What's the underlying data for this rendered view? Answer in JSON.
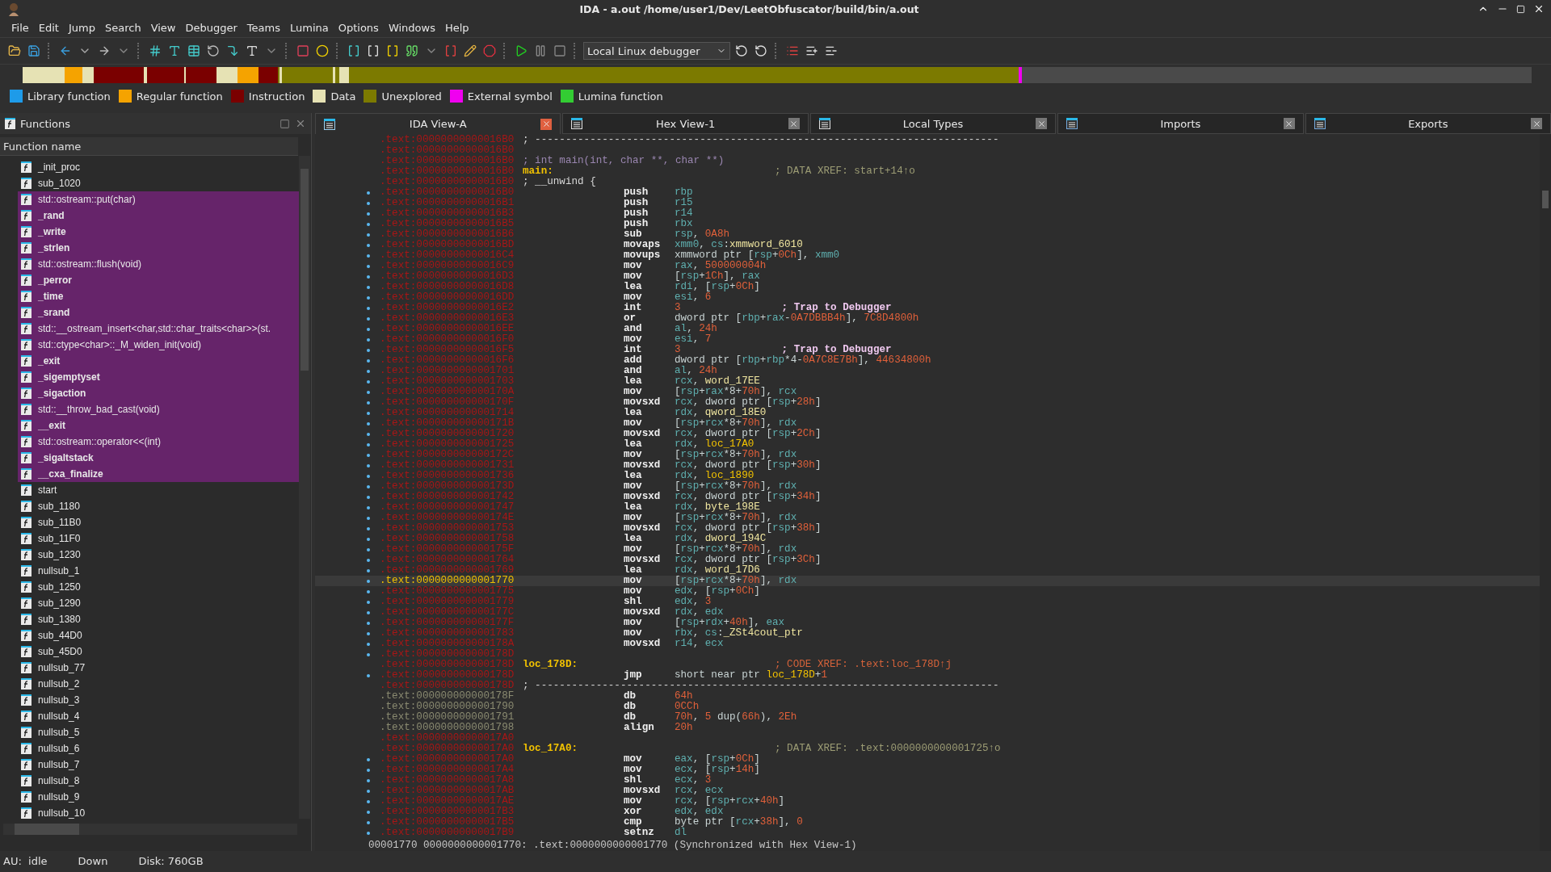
{
  "window": {
    "title": "IDA - a.out /home/user1/Dev/LeetObfuscator/build/bin/a.out"
  },
  "menu": [
    "File",
    "Edit",
    "Jump",
    "Search",
    "View",
    "Debugger",
    "Teams",
    "Lumina",
    "Options",
    "Windows",
    "Help"
  ],
  "toolbar": {
    "debugger_select": "Local Linux debugger"
  },
  "legend": [
    {
      "label": "Library function",
      "color": "#1e9be9"
    },
    {
      "label": "Regular function",
      "color": "#f5a300"
    },
    {
      "label": "Instruction",
      "color": "#7a0000"
    },
    {
      "label": "Data",
      "color": "#e6e2b4"
    },
    {
      "label": "Unexplored",
      "color": "#7c7a00"
    },
    {
      "label": "External symbol",
      "color": "#f000f0"
    },
    {
      "label": "Lumina function",
      "color": "#33cc33"
    }
  ],
  "functions": {
    "title": "Functions",
    "column": "Function name",
    "rows": [
      {
        "name": "_init_proc",
        "selected": false,
        "bold": false
      },
      {
        "name": "sub_1020",
        "selected": false,
        "bold": false
      },
      {
        "name": "std::ostream::put(char)",
        "selected": true,
        "bold": false
      },
      {
        "name": "_rand",
        "selected": true,
        "bold": true
      },
      {
        "name": "_write",
        "selected": true,
        "bold": true
      },
      {
        "name": "_strlen",
        "selected": true,
        "bold": true
      },
      {
        "name": "std::ostream::flush(void)",
        "selected": true,
        "bold": false
      },
      {
        "name": "_perror",
        "selected": true,
        "bold": true
      },
      {
        "name": "_time",
        "selected": true,
        "bold": true
      },
      {
        "name": "_srand",
        "selected": true,
        "bold": true
      },
      {
        "name": "std::__ostream_insert<char,std::char_traits<char>>(st.",
        "selected": true,
        "bold": false
      },
      {
        "name": "std::ctype<char>::_M_widen_init(void)",
        "selected": true,
        "bold": false
      },
      {
        "name": "_exit",
        "selected": true,
        "bold": true
      },
      {
        "name": "_sigemptyset",
        "selected": true,
        "bold": true
      },
      {
        "name": "_sigaction",
        "selected": true,
        "bold": true
      },
      {
        "name": "std::__throw_bad_cast(void)",
        "selected": true,
        "bold": false
      },
      {
        "name": "__exit",
        "selected": true,
        "bold": true
      },
      {
        "name": "std::ostream::operator<<(int)",
        "selected": true,
        "bold": false
      },
      {
        "name": "_sigaltstack",
        "selected": true,
        "bold": true
      },
      {
        "name": "__cxa_finalize",
        "selected": true,
        "bold": true
      },
      {
        "name": "start",
        "selected": false,
        "bold": false
      },
      {
        "name": "sub_1180",
        "selected": false,
        "bold": false
      },
      {
        "name": "sub_11B0",
        "selected": false,
        "bold": false
      },
      {
        "name": "sub_11F0",
        "selected": false,
        "bold": false
      },
      {
        "name": "sub_1230",
        "selected": false,
        "bold": false
      },
      {
        "name": "nullsub_1",
        "selected": false,
        "bold": false
      },
      {
        "name": "sub_1250",
        "selected": false,
        "bold": false
      },
      {
        "name": "sub_1290",
        "selected": false,
        "bold": false
      },
      {
        "name": "sub_1380",
        "selected": false,
        "bold": false
      },
      {
        "name": "sub_44D0",
        "selected": false,
        "bold": false
      },
      {
        "name": "sub_45D0",
        "selected": false,
        "bold": false
      },
      {
        "name": "nullsub_77",
        "selected": false,
        "bold": false
      },
      {
        "name": "nullsub_2",
        "selected": false,
        "bold": false
      },
      {
        "name": "nullsub_3",
        "selected": false,
        "bold": false
      },
      {
        "name": "nullsub_4",
        "selected": false,
        "bold": false
      },
      {
        "name": "nullsub_5",
        "selected": false,
        "bold": false
      },
      {
        "name": "nullsub_6",
        "selected": false,
        "bold": false
      },
      {
        "name": "nullsub_7",
        "selected": false,
        "bold": false
      },
      {
        "name": "nullsub_8",
        "selected": false,
        "bold": false
      },
      {
        "name": "nullsub_9",
        "selected": false,
        "bold": false
      },
      {
        "name": "nullsub_10",
        "selected": false,
        "bold": false
      }
    ]
  },
  "tabs": [
    {
      "label": "IDA View-A",
      "selected": true,
      "kind": "listing"
    },
    {
      "label": "Hex View-1",
      "selected": false,
      "kind": "hex"
    },
    {
      "label": "Local Types",
      "selected": false,
      "kind": "types"
    },
    {
      "label": "Imports",
      "selected": false,
      "kind": "imports"
    },
    {
      "label": "Exports",
      "selected": false,
      "kind": "exports"
    }
  ],
  "lines": [
    {
      "addr": ".text:00000000000016B0",
      "data": false,
      "selected": false,
      "dot": false,
      "kind": "comment",
      "comment": {
        "text": "; ----------------------------------------------------------------------------",
        "kind": "plain"
      }
    },
    {
      "addr": ".text:00000000000016B0",
      "data": false,
      "selected": false,
      "dot": false,
      "kind": "blank"
    },
    {
      "addr": ".text:00000000000016B0",
      "data": false,
      "selected": false,
      "dot": false,
      "kind": "comment",
      "comment": {
        "text": "; int main(int, char **, char **)",
        "kind": "proto"
      }
    },
    {
      "addr": ".text:00000000000016B0",
      "data": false,
      "selected": false,
      "dot": false,
      "kind": "label",
      "label": "main:",
      "comment": {
        "text": "; DATA XREF: start+14↑o",
        "kind": "xref"
      }
    },
    {
      "addr": ".text:00000000000016B0",
      "data": false,
      "selected": false,
      "dot": false,
      "kind": "comment",
      "comment": {
        "text": "; __unwind {",
        "kind": "plain"
      }
    },
    {
      "addr": ".text:00000000000016B0",
      "data": false,
      "selected": false,
      "dot": true,
      "kind": "code",
      "mnem": "push",
      "ops": [
        {
          "reg": "rbp"
        }
      ]
    },
    {
      "addr": ".text:00000000000016B1",
      "data": false,
      "selected": false,
      "dot": true,
      "kind": "code",
      "mnem": "push",
      "ops": [
        {
          "reg": "r15"
        }
      ]
    },
    {
      "addr": ".text:00000000000016B3",
      "data": false,
      "selected": false,
      "dot": true,
      "kind": "code",
      "mnem": "push",
      "ops": [
        {
          "reg": "r14"
        }
      ]
    },
    {
      "addr": ".text:00000000000016B5",
      "data": false,
      "selected": false,
      "dot": true,
      "kind": "code",
      "mnem": "push",
      "ops": [
        {
          "reg": "rbx"
        }
      ]
    },
    {
      "addr": ".text:00000000000016B6",
      "data": false,
      "selected": false,
      "dot": true,
      "kind": "code",
      "mnem": "sub",
      "ops": [
        {
          "reg": "rsp"
        },
        {
          "text": ", "
        },
        {
          "num": "0A8h"
        }
      ]
    },
    {
      "addr": ".text:00000000000016BD",
      "data": false,
      "selected": false,
      "dot": true,
      "kind": "code",
      "mnem": "movaps",
      "ops": [
        {
          "reg": "xmm0"
        },
        {
          "text": ", "
        },
        {
          "reg": "cs"
        },
        {
          "text": ":"
        },
        {
          "name": "xmmword_6010"
        }
      ]
    },
    {
      "addr": ".text:00000000000016C4",
      "data": false,
      "selected": false,
      "dot": true,
      "kind": "code",
      "mnem": "movups",
      "ops": [
        {
          "text": "xmmword ptr ["
        },
        {
          "reg": "rsp"
        },
        {
          "text": "+"
        },
        {
          "num": "0Ch"
        },
        {
          "text": "], "
        },
        {
          "reg": "xmm0"
        }
      ]
    },
    {
      "addr": ".text:00000000000016C9",
      "data": false,
      "selected": false,
      "dot": true,
      "kind": "code",
      "mnem": "mov",
      "ops": [
        {
          "reg": "rax"
        },
        {
          "text": ", "
        },
        {
          "num": "500000004h"
        }
      ]
    },
    {
      "addr": ".text:00000000000016D3",
      "data": false,
      "selected": false,
      "dot": true,
      "kind": "code",
      "mnem": "mov",
      "ops": [
        {
          "text": "["
        },
        {
          "reg": "rsp"
        },
        {
          "text": "+"
        },
        {
          "num": "1Ch"
        },
        {
          "text": "], "
        },
        {
          "reg": "rax"
        }
      ]
    },
    {
      "addr": ".text:00000000000016D8",
      "data": false,
      "selected": false,
      "dot": true,
      "kind": "code",
      "mnem": "lea",
      "ops": [
        {
          "reg": "rdi"
        },
        {
          "text": ", ["
        },
        {
          "reg": "rsp"
        },
        {
          "text": "+"
        },
        {
          "num": "0Ch"
        },
        {
          "text": "]"
        }
      ]
    },
    {
      "addr": ".text:00000000000016DD",
      "data": false,
      "selected": false,
      "dot": true,
      "kind": "code",
      "mnem": "mov",
      "ops": [
        {
          "reg": "esi"
        },
        {
          "text": ", "
        },
        {
          "num": "6"
        }
      ]
    },
    {
      "addr": ".text:00000000000016E2",
      "data": false,
      "selected": false,
      "dot": true,
      "kind": "code",
      "mnem": "int",
      "ops": [
        {
          "num": "3"
        }
      ],
      "comment": {
        "text": "; Trap to Debugger",
        "kind": "auto"
      }
    },
    {
      "addr": ".text:00000000000016E3",
      "data": false,
      "selected": false,
      "dot": true,
      "kind": "code",
      "mnem": "or",
      "ops": [
        {
          "text": "dword ptr ["
        },
        {
          "reg": "rbp"
        },
        {
          "text": "+"
        },
        {
          "reg": "rax"
        },
        {
          "text": "-"
        },
        {
          "num": "0A7DBBB4h"
        },
        {
          "text": "], "
        },
        {
          "num": "7C8D4800h"
        }
      ]
    },
    {
      "addr": ".text:00000000000016EE",
      "data": false,
      "selected": false,
      "dot": true,
      "kind": "code",
      "mnem": "and",
      "ops": [
        {
          "reg": "al"
        },
        {
          "text": ", "
        },
        {
          "num": "24h"
        }
      ]
    },
    {
      "addr": ".text:00000000000016F0",
      "data": false,
      "selected": false,
      "dot": true,
      "kind": "code",
      "mnem": "mov",
      "ops": [
        {
          "reg": "esi"
        },
        {
          "text": ", "
        },
        {
          "num": "7"
        }
      ]
    },
    {
      "addr": ".text:00000000000016F5",
      "data": false,
      "selected": false,
      "dot": true,
      "kind": "code",
      "mnem": "int",
      "ops": [
        {
          "num": "3"
        }
      ],
      "comment": {
        "text": "; Trap to Debugger",
        "kind": "auto"
      }
    },
    {
      "addr": ".text:00000000000016F6",
      "data": false,
      "selected": false,
      "dot": true,
      "kind": "code",
      "mnem": "add",
      "ops": [
        {
          "text": "dword ptr ["
        },
        {
          "reg": "rbp"
        },
        {
          "text": "+"
        },
        {
          "reg": "rbp"
        },
        {
          "text": "*4-"
        },
        {
          "num": "0A7C8E7Bh"
        },
        {
          "text": "], "
        },
        {
          "num": "44634800h"
        }
      ]
    },
    {
      "addr": ".text:0000000000001701",
      "data": false,
      "selected": false,
      "dot": true,
      "kind": "code",
      "mnem": "and",
      "ops": [
        {
          "reg": "al"
        },
        {
          "text": ", "
        },
        {
          "num": "24h"
        }
      ]
    },
    {
      "addr": ".text:0000000000001703",
      "data": false,
      "selected": false,
      "dot": true,
      "kind": "code",
      "mnem": "lea",
      "ops": [
        {
          "reg": "rcx"
        },
        {
          "text": ", "
        },
        {
          "name": "word_17EE"
        }
      ]
    },
    {
      "addr": ".text:000000000000170A",
      "data": false,
      "selected": false,
      "dot": true,
      "kind": "code",
      "mnem": "mov",
      "ops": [
        {
          "text": "["
        },
        {
          "reg": "rsp"
        },
        {
          "text": "+"
        },
        {
          "reg": "rax"
        },
        {
          "text": "*8+"
        },
        {
          "num": "70h"
        },
        {
          "text": "], "
        },
        {
          "reg": "rcx"
        }
      ]
    },
    {
      "addr": ".text:000000000000170F",
      "data": false,
      "selected": false,
      "dot": true,
      "kind": "code",
      "mnem": "movsxd",
      "ops": [
        {
          "reg": "rcx"
        },
        {
          "text": ", dword ptr ["
        },
        {
          "reg": "rsp"
        },
        {
          "text": "+"
        },
        {
          "num": "28h"
        },
        {
          "text": "]"
        }
      ]
    },
    {
      "addr": ".text:0000000000001714",
      "data": false,
      "selected": false,
      "dot": true,
      "kind": "code",
      "mnem": "lea",
      "ops": [
        {
          "reg": "rdx"
        },
        {
          "text": ", "
        },
        {
          "name": "qword_18E0"
        }
      ]
    },
    {
      "addr": ".text:000000000000171B",
      "data": false,
      "selected": false,
      "dot": true,
      "kind": "code",
      "mnem": "mov",
      "ops": [
        {
          "text": "["
        },
        {
          "reg": "rsp"
        },
        {
          "text": "+"
        },
        {
          "reg": "rcx"
        },
        {
          "text": "*8+"
        },
        {
          "num": "70h"
        },
        {
          "text": "], "
        },
        {
          "reg": "rdx"
        }
      ]
    },
    {
      "addr": ".text:0000000000001720",
      "data": false,
      "selected": false,
      "dot": true,
      "kind": "code",
      "mnem": "movsxd",
      "ops": [
        {
          "reg": "rcx"
        },
        {
          "text": ", dword ptr ["
        },
        {
          "reg": "rsp"
        },
        {
          "text": "+"
        },
        {
          "num": "2Ch"
        },
        {
          "text": "]"
        }
      ]
    },
    {
      "addr": ".text:0000000000001725",
      "data": false,
      "selected": false,
      "dot": true,
      "kind": "code",
      "mnem": "lea",
      "ops": [
        {
          "reg": "rdx"
        },
        {
          "text": ", "
        },
        {
          "loc": "loc_17A0"
        }
      ]
    },
    {
      "addr": ".text:000000000000172C",
      "data": false,
      "selected": false,
      "dot": true,
      "kind": "code",
      "mnem": "mov",
      "ops": [
        {
          "text": "["
        },
        {
          "reg": "rsp"
        },
        {
          "text": "+"
        },
        {
          "reg": "rcx"
        },
        {
          "text": "*8+"
        },
        {
          "num": "70h"
        },
        {
          "text": "], "
        },
        {
          "reg": "rdx"
        }
      ]
    },
    {
      "addr": ".text:0000000000001731",
      "data": false,
      "selected": false,
      "dot": true,
      "kind": "code",
      "mnem": "movsxd",
      "ops": [
        {
          "reg": "rcx"
        },
        {
          "text": ", dword ptr ["
        },
        {
          "reg": "rsp"
        },
        {
          "text": "+"
        },
        {
          "num": "30h"
        },
        {
          "text": "]"
        }
      ]
    },
    {
      "addr": ".text:0000000000001736",
      "data": false,
      "selected": false,
      "dot": true,
      "kind": "code",
      "mnem": "lea",
      "ops": [
        {
          "reg": "rdx"
        },
        {
          "text": ", "
        },
        {
          "loc": "loc_1890"
        }
      ]
    },
    {
      "addr": ".text:000000000000173D",
      "data": false,
      "selected": false,
      "dot": true,
      "kind": "code",
      "mnem": "mov",
      "ops": [
        {
          "text": "["
        },
        {
          "reg": "rsp"
        },
        {
          "text": "+"
        },
        {
          "reg": "rcx"
        },
        {
          "text": "*8+"
        },
        {
          "num": "70h"
        },
        {
          "text": "], "
        },
        {
          "reg": "rdx"
        }
      ]
    },
    {
      "addr": ".text:0000000000001742",
      "data": false,
      "selected": false,
      "dot": true,
      "kind": "code",
      "mnem": "movsxd",
      "ops": [
        {
          "reg": "rcx"
        },
        {
          "text": ", dword ptr ["
        },
        {
          "reg": "rsp"
        },
        {
          "text": "+"
        },
        {
          "num": "34h"
        },
        {
          "text": "]"
        }
      ]
    },
    {
      "addr": ".text:0000000000001747",
      "data": false,
      "selected": false,
      "dot": true,
      "kind": "code",
      "mnem": "lea",
      "ops": [
        {
          "reg": "rdx"
        },
        {
          "text": ", "
        },
        {
          "name": "byte_198E"
        }
      ]
    },
    {
      "addr": ".text:000000000000174E",
      "data": false,
      "selected": false,
      "dot": true,
      "kind": "code",
      "mnem": "mov",
      "ops": [
        {
          "text": "["
        },
        {
          "reg": "rsp"
        },
        {
          "text": "+"
        },
        {
          "reg": "rcx"
        },
        {
          "text": "*8+"
        },
        {
          "num": "70h"
        },
        {
          "text": "], "
        },
        {
          "reg": "rdx"
        }
      ]
    },
    {
      "addr": ".text:0000000000001753",
      "data": false,
      "selected": false,
      "dot": true,
      "kind": "code",
      "mnem": "movsxd",
      "ops": [
        {
          "reg": "rcx"
        },
        {
          "text": ", dword ptr ["
        },
        {
          "reg": "rsp"
        },
        {
          "text": "+"
        },
        {
          "num": "38h"
        },
        {
          "text": "]"
        }
      ]
    },
    {
      "addr": ".text:0000000000001758",
      "data": false,
      "selected": false,
      "dot": true,
      "kind": "code",
      "mnem": "lea",
      "ops": [
        {
          "reg": "rdx"
        },
        {
          "text": ", "
        },
        {
          "name": "dword_194C"
        }
      ]
    },
    {
      "addr": ".text:000000000000175F",
      "data": false,
      "selected": false,
      "dot": true,
      "kind": "code",
      "mnem": "mov",
      "ops": [
        {
          "text": "["
        },
        {
          "reg": "rsp"
        },
        {
          "text": "+"
        },
        {
          "reg": "rcx"
        },
        {
          "text": "*8+"
        },
        {
          "num": "70h"
        },
        {
          "text": "], "
        },
        {
          "reg": "rdx"
        }
      ]
    },
    {
      "addr": ".text:0000000000001764",
      "data": false,
      "selected": false,
      "dot": true,
      "kind": "code",
      "mnem": "movsxd",
      "ops": [
        {
          "reg": "rcx"
        },
        {
          "text": ", dword ptr ["
        },
        {
          "reg": "rsp"
        },
        {
          "text": "+"
        },
        {
          "num": "3Ch"
        },
        {
          "text": "]"
        }
      ]
    },
    {
      "addr": ".text:0000000000001769",
      "data": false,
      "selected": false,
      "dot": true,
      "kind": "code",
      "mnem": "lea",
      "ops": [
        {
          "reg": "rdx"
        },
        {
          "text": ", "
        },
        {
          "name": "word_17D6"
        }
      ]
    },
    {
      "addr": ".text:0000000000001770",
      "data": false,
      "selected": true,
      "dot": true,
      "kind": "code",
      "mnem": "mov",
      "ops": [
        {
          "text": "["
        },
        {
          "reg": "rsp"
        },
        {
          "text": "+"
        },
        {
          "reg": "rcx"
        },
        {
          "text": "*8+"
        },
        {
          "num": "70h"
        },
        {
          "text": "], "
        },
        {
          "reg": "rdx"
        }
      ]
    },
    {
      "addr": ".text:0000000000001775",
      "data": false,
      "selected": false,
      "dot": true,
      "kind": "code",
      "mnem": "mov",
      "ops": [
        {
          "reg": "edx"
        },
        {
          "text": ", ["
        },
        {
          "reg": "rsp"
        },
        {
          "text": "+"
        },
        {
          "num": "0Ch"
        },
        {
          "text": "]"
        }
      ]
    },
    {
      "addr": ".text:0000000000001779",
      "data": false,
      "selected": false,
      "dot": true,
      "kind": "code",
      "mnem": "shl",
      "ops": [
        {
          "reg": "edx"
        },
        {
          "text": ", "
        },
        {
          "num": "3"
        }
      ]
    },
    {
      "addr": ".text:000000000000177C",
      "data": false,
      "selected": false,
      "dot": true,
      "kind": "code",
      "mnem": "movsxd",
      "ops": [
        {
          "reg": "rdx"
        },
        {
          "text": ", "
        },
        {
          "reg": "edx"
        }
      ]
    },
    {
      "addr": ".text:000000000000177F",
      "data": false,
      "selected": false,
      "dot": true,
      "kind": "code",
      "mnem": "mov",
      "ops": [
        {
          "text": "["
        },
        {
          "reg": "rsp"
        },
        {
          "text": "+"
        },
        {
          "reg": "rdx"
        },
        {
          "text": "+"
        },
        {
          "num": "40h"
        },
        {
          "text": "], "
        },
        {
          "reg": "eax"
        }
      ]
    },
    {
      "addr": ".text:0000000000001783",
      "data": false,
      "selected": false,
      "dot": true,
      "kind": "code",
      "mnem": "mov",
      "ops": [
        {
          "reg": "rbx"
        },
        {
          "text": ", "
        },
        {
          "reg": "cs"
        },
        {
          "text": ":"
        },
        {
          "name": "_ZSt4cout_ptr"
        }
      ]
    },
    {
      "addr": ".text:000000000000178A",
      "data": false,
      "selected": false,
      "dot": true,
      "kind": "code",
      "mnem": "movsxd",
      "ops": [
        {
          "reg": "r14"
        },
        {
          "text": ", "
        },
        {
          "reg": "ecx"
        }
      ]
    },
    {
      "addr": ".text:000000000000178D",
      "data": false,
      "selected": false,
      "dot": true,
      "kind": "blank"
    },
    {
      "addr": ".text:000000000000178D",
      "data": false,
      "selected": false,
      "dot": false,
      "kind": "label",
      "label": "loc_178D:",
      "comment": {
        "text": "; CODE XREF: .text:loc_178D↑j",
        "kind": "code_xref"
      }
    },
    {
      "addr": ".text:000000000000178D",
      "data": false,
      "selected": false,
      "dot": true,
      "kind": "code",
      "mnem": "jmp",
      "ops": [
        {
          "text": "short near ptr "
        },
        {
          "loc": "loc_178D"
        },
        {
          "text": "+"
        },
        {
          "num": "1"
        }
      ]
    },
    {
      "addr": ".text:000000000000178D",
      "data": false,
      "selected": false,
      "dot": false,
      "kind": "comment",
      "comment": {
        "text": "; ----------------------------------------------------------------------------",
        "kind": "plain"
      }
    },
    {
      "addr": ".text:000000000000178F",
      "data": true,
      "selected": false,
      "dot": false,
      "kind": "code",
      "mnem": "db",
      "ops": [
        {
          "num": "64h"
        }
      ]
    },
    {
      "addr": ".text:0000000000001790",
      "data": true,
      "selected": false,
      "dot": false,
      "kind": "code",
      "mnem": "db",
      "ops": [
        {
          "num": "0CCh"
        }
      ]
    },
    {
      "addr": ".text:0000000000001791",
      "data": true,
      "selected": false,
      "dot": false,
      "kind": "code",
      "mnem": "db",
      "ops": [
        {
          "num": "70h"
        },
        {
          "text": ", "
        },
        {
          "num": "5"
        },
        {
          "text": " dup("
        },
        {
          "num": "66h"
        },
        {
          "text": "), "
        },
        {
          "num": "2Eh"
        }
      ]
    },
    {
      "addr": ".text:0000000000001798",
      "data": true,
      "selected": false,
      "dot": false,
      "kind": "code",
      "mnem": "align",
      "ops": [
        {
          "num": "20h"
        }
      ]
    },
    {
      "addr": ".text:00000000000017A0",
      "data": false,
      "selected": false,
      "dot": false,
      "kind": "blank"
    },
    {
      "addr": ".text:00000000000017A0",
      "data": false,
      "selected": false,
      "dot": false,
      "kind": "label",
      "label": "loc_17A0:",
      "comment": {
        "text": "; DATA XREF: .text:0000000000001725↑o",
        "kind": "xref"
      }
    },
    {
      "addr": ".text:00000000000017A0",
      "data": false,
      "selected": false,
      "dot": true,
      "kind": "code",
      "mnem": "mov",
      "ops": [
        {
          "reg": "eax"
        },
        {
          "text": ", ["
        },
        {
          "reg": "rsp"
        },
        {
          "text": "+"
        },
        {
          "num": "0Ch"
        },
        {
          "text": "]"
        }
      ]
    },
    {
      "addr": ".text:00000000000017A4",
      "data": false,
      "selected": false,
      "dot": true,
      "kind": "code",
      "mnem": "mov",
      "ops": [
        {
          "reg": "ecx"
        },
        {
          "text": ", ["
        },
        {
          "reg": "rsp"
        },
        {
          "text": "+"
        },
        {
          "num": "14h"
        },
        {
          "text": "]"
        }
      ]
    },
    {
      "addr": ".text:00000000000017A8",
      "data": false,
      "selected": false,
      "dot": true,
      "kind": "code",
      "mnem": "shl",
      "ops": [
        {
          "reg": "ecx"
        },
        {
          "text": ", "
        },
        {
          "num": "3"
        }
      ]
    },
    {
      "addr": ".text:00000000000017AB",
      "data": false,
      "selected": false,
      "dot": true,
      "kind": "code",
      "mnem": "movsxd",
      "ops": [
        {
          "reg": "rcx"
        },
        {
          "text": ", "
        },
        {
          "reg": "ecx"
        }
      ]
    },
    {
      "addr": ".text:00000000000017AE",
      "data": false,
      "selected": false,
      "dot": true,
      "kind": "code",
      "mnem": "mov",
      "ops": [
        {
          "reg": "rcx"
        },
        {
          "text": ", ["
        },
        {
          "reg": "rsp"
        },
        {
          "text": "+"
        },
        {
          "reg": "rcx"
        },
        {
          "text": "+"
        },
        {
          "num": "40h"
        },
        {
          "text": "]"
        }
      ]
    },
    {
      "addr": ".text:00000000000017B3",
      "data": false,
      "selected": false,
      "dot": true,
      "kind": "code",
      "mnem": "xor",
      "ops": [
        {
          "reg": "edx"
        },
        {
          "text": ", "
        },
        {
          "reg": "edx"
        }
      ]
    },
    {
      "addr": ".text:00000000000017B5",
      "data": false,
      "selected": false,
      "dot": true,
      "kind": "code",
      "mnem": "cmp",
      "ops": [
        {
          "text": "byte ptr ["
        },
        {
          "reg": "rcx"
        },
        {
          "text": "+"
        },
        {
          "num": "38h"
        },
        {
          "text": "], "
        },
        {
          "num": "0"
        }
      ]
    },
    {
      "addr": ".text:00000000000017B9",
      "data": false,
      "selected": false,
      "dot": true,
      "kind": "code",
      "mnem": "setnz",
      "ops": [
        {
          "reg": "dl"
        }
      ]
    }
  ],
  "status_line": "00001770 0000000000001770: .text:0000000000001770 (Synchronized with Hex View-1)",
  "status_bar": [
    "AU:  idle",
    "Down",
    "Disk: 760GB"
  ]
}
